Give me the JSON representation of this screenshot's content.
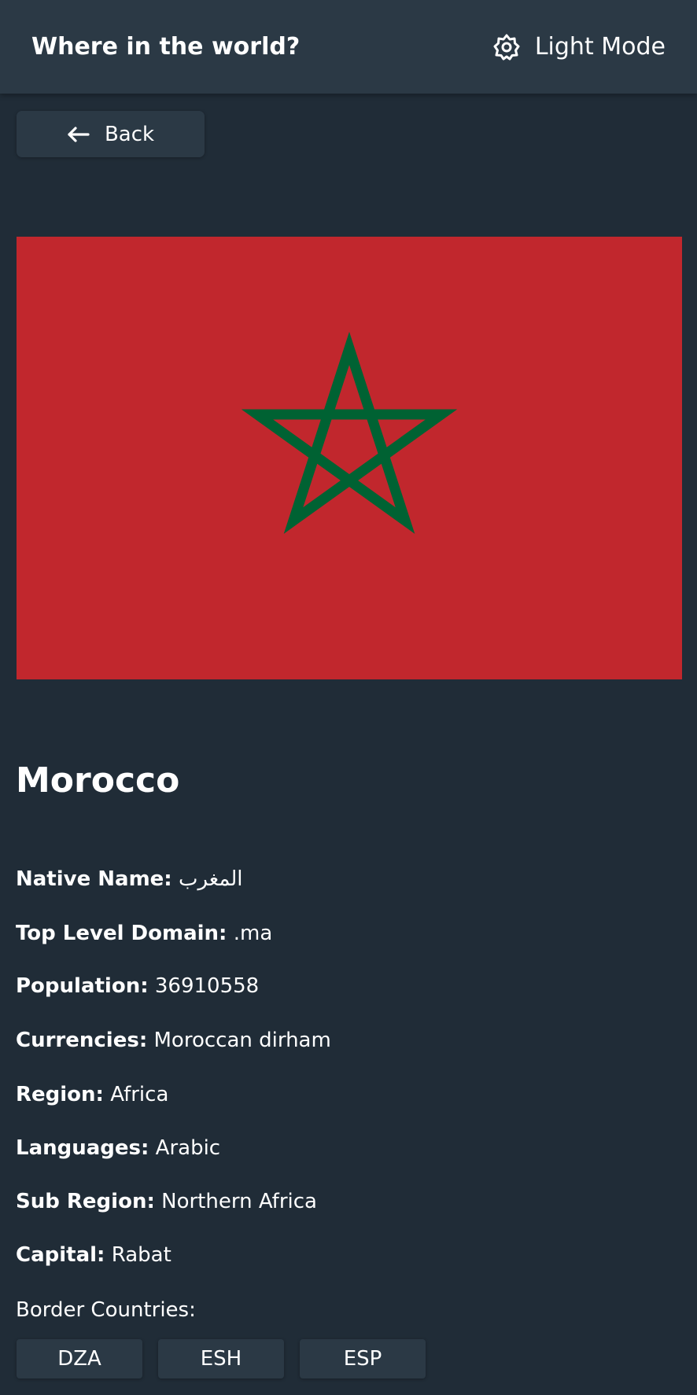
{
  "header": {
    "title": "Where in the world?",
    "theme_toggle_label": "Light Mode",
    "theme_icon": "gear-icon"
  },
  "back_button": {
    "label": "Back",
    "icon": "arrow-left-icon"
  },
  "country": {
    "name": "Morocco",
    "flag": {
      "description_icon": "flag-morocco",
      "field_color": "#c1272d",
      "star_color": "#006233"
    },
    "details": [
      {
        "label": "Native Name:",
        "value": "المغرب"
      },
      {
        "label": "Top Level Domain:",
        "value": ".ma"
      },
      {
        "label": "Population:",
        "value": "36910558"
      },
      {
        "label": "Currencies:",
        "value": "Moroccan dirham"
      },
      {
        "label": "Region:",
        "value": "Africa"
      },
      {
        "label": "Languages:",
        "value": "Arabic"
      },
      {
        "label": "Sub Region:",
        "value": "Northern Africa"
      },
      {
        "label": "Capital:",
        "value": "Rabat"
      }
    ],
    "border_countries_label": "Border Countries:",
    "border_countries": [
      "DZA",
      "ESH",
      "ESP"
    ]
  },
  "colors": {
    "background": "#202c37",
    "element": "#2b3945",
    "text": "#ffffff"
  }
}
